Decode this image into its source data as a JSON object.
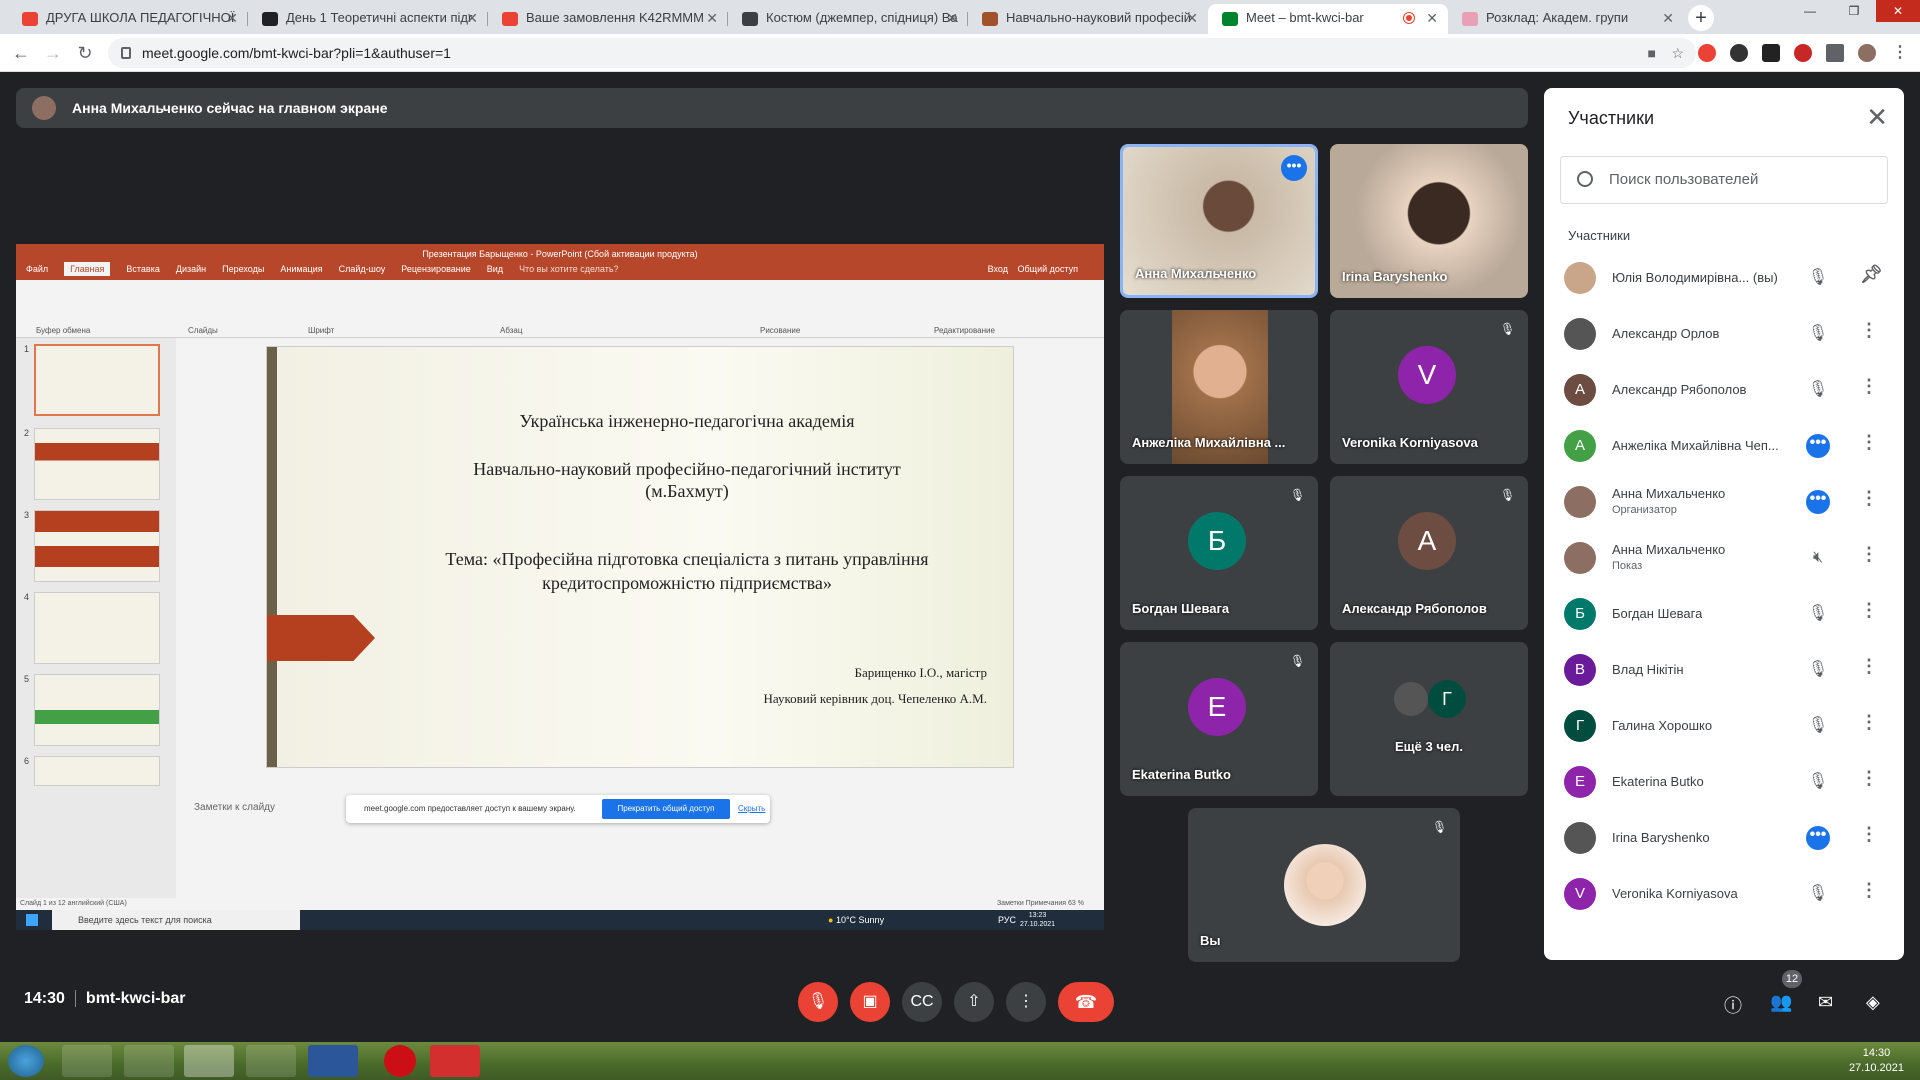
{
  "browser": {
    "tabs": [
      {
        "title": "ДРУГА ШКОЛА ПЕДАГОГІЧНОЇ",
        "color": "#ea4335"
      },
      {
        "title": "День 1 Теоретичні аспекти підг",
        "color": "#202124"
      },
      {
        "title": "Ваше замовлення K42RMMM",
        "color": "#ea4335"
      },
      {
        "title": "Костюм (джемпер, спідниця) Ва",
        "color": "#3c4043"
      },
      {
        "title": "Навчально-науковий професій",
        "color": "#a0522d"
      },
      {
        "title": "Meet – bmt-kwci-bar",
        "color": "#00832d"
      },
      {
        "title": "Розклад: Академ. групи",
        "color": "#e8a0b4"
      }
    ],
    "url": "meet.google.com/bmt-kwci-bar?pli=1&authuser=1"
  },
  "banner": {
    "text": "Анна Михальченко сейчас на главном экране"
  },
  "ppt": {
    "title": "Презентация Барыщенко - PowerPoint (Сбой активации продукта)",
    "tabs": [
      "Файл",
      "Главная",
      "Вставка",
      "Дизайн",
      "Переходы",
      "Анимация",
      "Слайд-шоу",
      "Рецензирование",
      "Вид",
      "Что вы хотите сделать?"
    ],
    "login": "Вход",
    "share": "Общий доступ",
    "groups": [
      "Буфер обмена",
      "Слайды",
      "Шрифт",
      "Абзац",
      "Рисование",
      "Редактирование"
    ],
    "slide_lines": [
      "Українська інженерно-педагогічна академія",
      "Навчально-науковий професійно-педагогічний інститут",
      "(м.Бахмут)",
      "Тема: «Професійна підготовка спеціаліста з питань управління",
      "кредитоспроможністю підприємства»",
      "Барищенко І.О., магістр",
      "Науковий керівник доц. Чепеленко А.М."
    ],
    "thumb_numbers": [
      "1",
      "2",
      "3",
      "4",
      "5",
      "6"
    ],
    "notes": "Заметки к слайду",
    "status": "Слайд 1 из 12    английский (США)",
    "status_right": "Заметки    Примечания        63 %",
    "popup_text": "meet.google.com предоставляет доступ к вашему экрану.",
    "popup_stop": "Прекратить общий доступ",
    "popup_hide": "Скрыть",
    "taskbar_search": "Введите здесь текст для поиска",
    "weather": "10°C  Sunny",
    "lang": "РУС",
    "time": "13:23",
    "date": "27.10.2021"
  },
  "tiles": [
    {
      "name": "Анна Михальченко",
      "type": "photo",
      "color": "#c9b9a6"
    },
    {
      "name": "Irina Baryshenko",
      "type": "photo",
      "color": "#b9a999"
    },
    {
      "name": "Анжеліка Михайлівна ...",
      "type": "photo",
      "color": "#c48a63"
    },
    {
      "name": "Veronika Korniyasova",
      "letter": "V",
      "color": "#8e24aa"
    },
    {
      "name": "Богдан Шевага",
      "letter": "Б",
      "color": "#00796b"
    },
    {
      "name": "Александр Рябополов",
      "letter": "А",
      "color": "#6d4c41"
    },
    {
      "name": "Ekaterina Butko",
      "letter": "E",
      "color": "#8e24aa"
    },
    {
      "name": "Ещё 3 чел.",
      "letter": "Г",
      "color": "#004d40"
    },
    {
      "name": "Вы",
      "type": "photo",
      "color": "#e8c8b0"
    }
  ],
  "panel": {
    "title": "Участники",
    "search_placeholder": "Поиск пользователей",
    "subheader": "Участники",
    "people": [
      {
        "name": "Юлія Володимирівна... (вы)",
        "letter": "",
        "color": "#c9a68a",
        "status": "muted"
      },
      {
        "name": "Александр Орлов",
        "letter": "",
        "color": "#555",
        "status": "muted"
      },
      {
        "name": "Александр Рябополов",
        "letter": "А",
        "color": "#6d4c41",
        "status": "muted"
      },
      {
        "name": "Анжеліка Михайлівна Чеп...",
        "letter": "А",
        "color": "#43a047",
        "status": "talking"
      },
      {
        "name": "Анна Михальченко",
        "role": "Организатор",
        "letter": "",
        "color": "#8d6e63",
        "status": "talking"
      },
      {
        "name": "Анна Михальченко",
        "role": "Показ",
        "letter": "",
        "color": "#8d6e63",
        "status": "sound-off"
      },
      {
        "name": "Богдан Шевага",
        "letter": "Б",
        "color": "#00796b",
        "status": "muted"
      },
      {
        "name": "Влад Нікітін",
        "letter": "В",
        "color": "#6a1b9a",
        "status": "muted"
      },
      {
        "name": "Галина Хорошко",
        "letter": "Г",
        "color": "#004d40",
        "status": "muted"
      },
      {
        "name": "Ekaterina Butko",
        "letter": "E",
        "color": "#8e24aa",
        "status": "muted"
      },
      {
        "name": "Irina Baryshenko",
        "letter": "",
        "color": "#555",
        "status": "talking"
      },
      {
        "name": "Veronika Korniyasova",
        "letter": "V",
        "color": "#8e24aa",
        "status": "muted"
      }
    ]
  },
  "bottom": {
    "time": "14:30",
    "code": "bmt-kwci-bar",
    "people_count": "12"
  },
  "os": {
    "time": "14:30",
    "date": "27.10.2021"
  }
}
